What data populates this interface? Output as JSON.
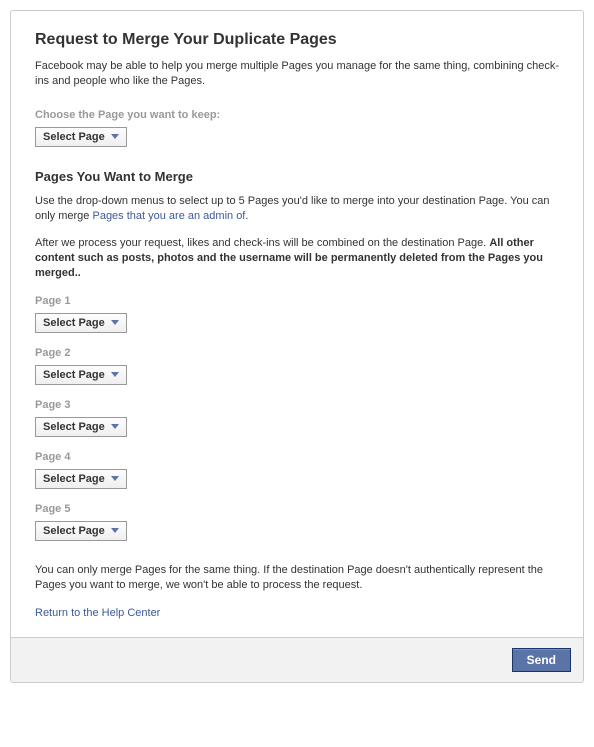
{
  "title": "Request to Merge Your Duplicate Pages",
  "intro": "Facebook may be able to help you merge multiple Pages you manage for the same thing, combining check-ins and people who like the Pages.",
  "keepSection": {
    "label": "Choose the Page you want to keep:",
    "selectLabel": "Select Page"
  },
  "mergeSection": {
    "heading": "Pages You Want to Merge",
    "para1_prefix": "Use the drop-down menus to select up to 5 Pages you'd like to merge into your destination Page. You can only merge ",
    "para1_link": "Pages that you are an admin of",
    "para1_suffix": ".",
    "para2_plain": "After we process your request, likes and check-ins will be combined on the destination Page. ",
    "para2_bold": "All other content such as posts, photos and the username will be permanently deleted from the Pages you merged..",
    "pages": [
      {
        "label": "Page 1",
        "selectLabel": "Select Page"
      },
      {
        "label": "Page 2",
        "selectLabel": "Select Page"
      },
      {
        "label": "Page 3",
        "selectLabel": "Select Page"
      },
      {
        "label": "Page 4",
        "selectLabel": "Select Page"
      },
      {
        "label": "Page 5",
        "selectLabel": "Select Page"
      }
    ]
  },
  "footerNote": "You can only merge Pages for the same thing. If the destination Page doesn't authentically represent the Pages you want to merge, we won't be able to process the request.",
  "returnLink": "Return to the Help Center",
  "sendLabel": "Send"
}
